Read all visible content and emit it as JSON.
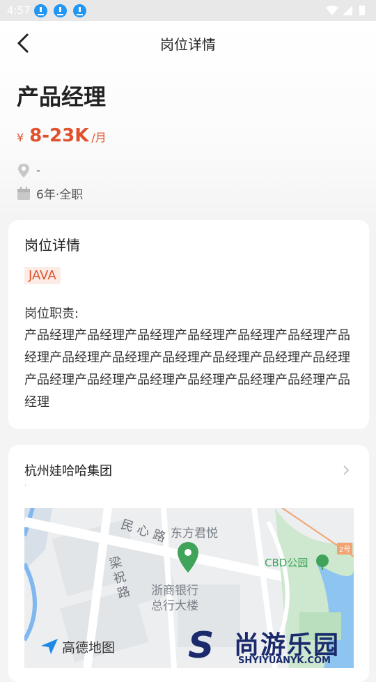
{
  "status": {
    "time": "4:57"
  },
  "nav": {
    "title": "岗位详情"
  },
  "job": {
    "title": "产品经理",
    "salary_currency": "¥",
    "salary_range": "8-23K",
    "salary_unit": "/月",
    "location": "-",
    "experience_type": "6年·全职"
  },
  "detail_card": {
    "heading": "岗位详情",
    "tag": "JAVA",
    "desc_label": "岗位职责:",
    "desc_text": "产品经理产品经理产品经理产品经理产品经理产品经理产品经理产品经理产品经理产品经理产品经理产品经理产品经理产品经理产品经理产品经理产品经理产品经理产品经理产品经理"
  },
  "company_card": {
    "name": "杭州娃哈哈集团",
    "sub": "."
  },
  "map": {
    "road_1": "民心路",
    "road_2": "梁祝路",
    "place_1": "东方君悦",
    "place_2": "浙商银行",
    "place_3": "总行大楼",
    "poi": "CBD公园",
    "road_badge": "2号",
    "logo": "高德地图"
  },
  "watermark": {
    "brand_text": "尚游乐园",
    "url": "SHYIYUANYK.COM"
  },
  "colors": {
    "accent": "#e0502c",
    "tag_bg": "#fdece5",
    "map_pin": "#3fa35a"
  }
}
